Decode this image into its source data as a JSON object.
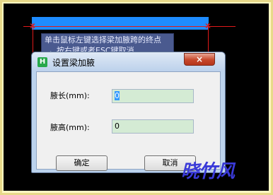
{
  "tooltip": {
    "line1": "单击鼠标左键选择梁加腋跨的终点",
    "line2": "，按右键或者ESC键取消"
  },
  "dialog": {
    "title": "设置梁加腋",
    "close_label": "×",
    "fields": [
      {
        "label": "腋长(mm):",
        "value": "0"
      },
      {
        "label": "腋高(mm):",
        "value": "0"
      }
    ],
    "ok_label": "确定",
    "cancel_label": "取消"
  },
  "watermark": "晓竹风",
  "colors": {
    "canvas_bg": "#000000",
    "beam": "#1e8cff",
    "cad_line": "#e01919",
    "input_bg": "#d4ebd4",
    "close_button": "#c6472a"
  }
}
